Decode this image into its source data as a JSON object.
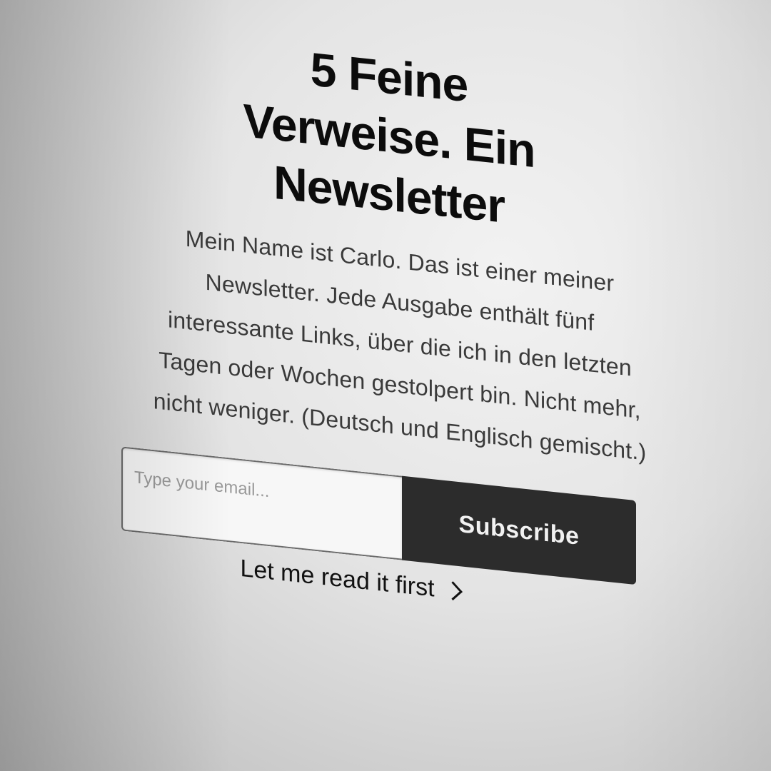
{
  "hero": {
    "title": "5 Feine Verweise. Ein Newsletter",
    "description": "Mein Name ist Carlo. Das ist einer meiner Newsletter. Jede Ausgabe enthält fünf interessante Links, über die ich in den letzten Tagen oder Wochen gestolpert bin. Nicht mehr, nicht weniger. (Deutsch und Englisch gemischt.)"
  },
  "signup": {
    "email_placeholder": "Type your email...",
    "email_value": "",
    "subscribe_label": "Subscribe",
    "read_first_label": "Let me read it first",
    "read_first_icon": "chevron-right-icon"
  },
  "colors": {
    "background": "#e6e6e6",
    "title_text": "#0c0c0c",
    "body_text": "#3a3a3a",
    "button_bg": "#2c2c2c",
    "button_text": "#f1f1f1"
  }
}
